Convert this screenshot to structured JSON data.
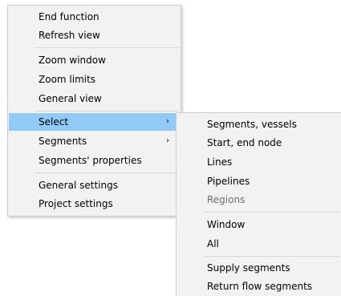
{
  "main_menu": {
    "items": [
      {
        "label": "End function"
      },
      {
        "label": "Refresh view"
      },
      {
        "label": "Zoom window"
      },
      {
        "label": "Zoom limits"
      },
      {
        "label": "General view"
      },
      {
        "label": "Select",
        "submenu_arrow": "›",
        "highlighted": true
      },
      {
        "label": "Segments",
        "submenu_arrow": "›"
      },
      {
        "label": "Segments' properties"
      },
      {
        "label": "General settings"
      },
      {
        "label": "Project settings"
      }
    ]
  },
  "sub_menu": {
    "items": [
      {
        "label": "Segments, vessels"
      },
      {
        "label": "Start, end node"
      },
      {
        "label": "Lines"
      },
      {
        "label": "Pipelines"
      },
      {
        "label": "Regions",
        "disabled": true
      },
      {
        "label": "Window"
      },
      {
        "label": "All"
      },
      {
        "label": "Supply segments"
      },
      {
        "label": "Return flow segments"
      }
    ]
  },
  "colors": {
    "menu_background": "#f2f2f2",
    "highlight": "#91c9f7",
    "disabled_text": "#6d6d6d",
    "separator": "#d7d7d7"
  }
}
